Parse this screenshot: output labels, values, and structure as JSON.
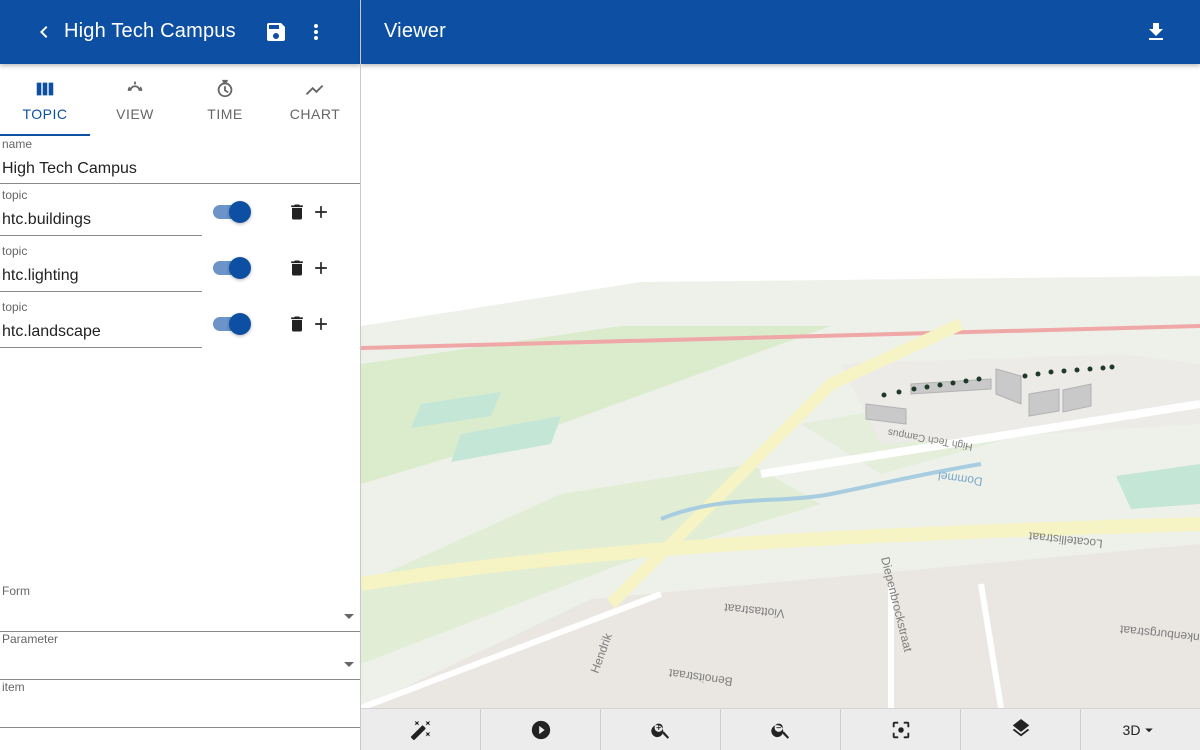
{
  "left_header": {
    "title": "High Tech Campus"
  },
  "right_header": {
    "title": "Viewer"
  },
  "tabs": [
    {
      "label": "TOPIC",
      "icon": "columns-icon",
      "active": true
    },
    {
      "label": "VIEW",
      "icon": "view-icon",
      "active": false
    },
    {
      "label": "TIME",
      "icon": "time-icon",
      "active": false
    },
    {
      "label": "CHART",
      "icon": "chart-icon",
      "active": false
    }
  ],
  "name_field": {
    "label": "name",
    "value": "High Tech Campus"
  },
  "topics": [
    {
      "label": "topic",
      "value": "htc.buildings",
      "enabled": true
    },
    {
      "label": "topic",
      "value": "htc.lighting",
      "enabled": true
    },
    {
      "label": "topic",
      "value": "htc.landscape",
      "enabled": true
    }
  ],
  "form_field": {
    "label": "Form",
    "value": ""
  },
  "parameter_field": {
    "label": "Parameter",
    "value": ""
  },
  "item_field": {
    "label": "item",
    "value": ""
  },
  "map": {
    "labels": {
      "high_tech_campus": "High Tech Campus",
      "dommel": "Dommel",
      "locatellistraat": "Locatellistraat",
      "viottastraat": "Viottastraat",
      "diepenbrockstraat": "Diepenbrockstraat",
      "benoitstraat": "Benoitstraat",
      "hendrik": "Hendrik",
      "nkenburgstraat": "nkenburgstraat"
    }
  },
  "toolbar": {
    "buttons": [
      {
        "name": "magic-wand-button",
        "icon": "magic-wand-icon"
      },
      {
        "name": "play-button",
        "icon": "play-icon"
      },
      {
        "name": "zoom-in-button",
        "icon": "zoom-in-icon"
      },
      {
        "name": "zoom-out-button",
        "icon": "zoom-out-icon"
      },
      {
        "name": "focus-button",
        "icon": "focus-icon"
      },
      {
        "name": "layers-button",
        "icon": "layers-icon"
      }
    ],
    "mode_label": "3D"
  },
  "colors": {
    "primary": "#0d50a3",
    "toggle_track": "#6c94c8",
    "toolbar_bg": "#ececec"
  }
}
